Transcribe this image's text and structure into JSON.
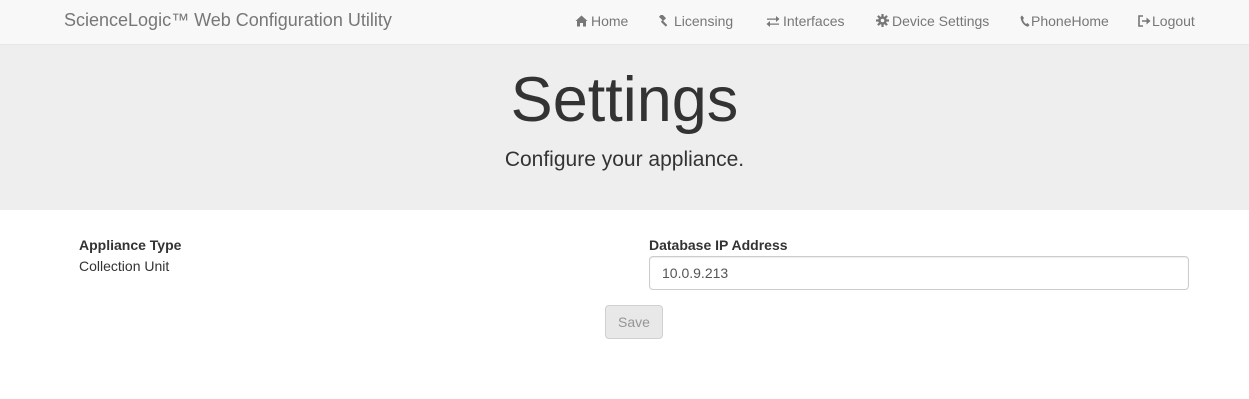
{
  "navbar": {
    "brand": "ScienceLogic™ Web Configuration Utility",
    "items": [
      {
        "label": "Home",
        "icon": "home-icon"
      },
      {
        "label": "Licensing",
        "icon": "gavel-icon"
      },
      {
        "label": "Interfaces",
        "icon": "exchange-icon"
      },
      {
        "label": "Device Settings",
        "icon": "cog-icon"
      },
      {
        "label": "PhoneHome",
        "icon": "phone-icon"
      },
      {
        "label": "Logout",
        "icon": "log-out-icon"
      }
    ]
  },
  "jumbotron": {
    "title": "Settings",
    "subtitle": "Configure your appliance."
  },
  "form": {
    "appliance_type_label": "Appliance Type",
    "appliance_type_value": "Collection Unit",
    "db_ip_label": "Database IP Address",
    "db_ip_value": "10.0.9.213",
    "save_label": "Save"
  },
  "colors": {
    "navbar_bg": "#f8f8f8",
    "jumbotron_bg": "#eeeeee",
    "nav_text": "#777777"
  }
}
